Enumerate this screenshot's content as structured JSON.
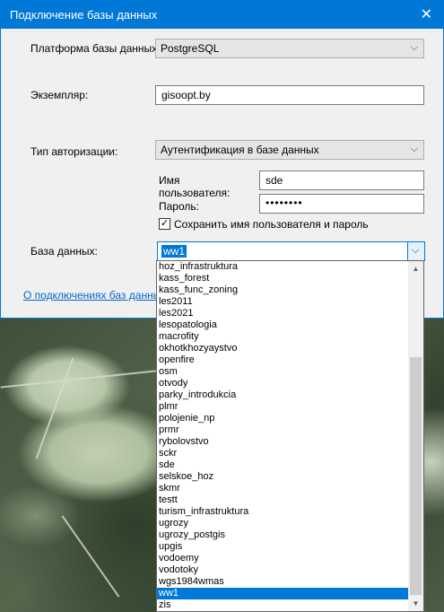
{
  "window": {
    "title": "Подключение базы данных",
    "close_glyph": "✕"
  },
  "form": {
    "platform_label": "Платформа базы данных:",
    "platform_value": "PostgreSQL",
    "instance_label": "Экземпляр:",
    "instance_value": "gisoopt.by",
    "auth_label": "Тип авторизации:",
    "auth_value": "Аутентификация в базе данных",
    "username_label_line1": "Имя",
    "username_label_line2": "пользователя:",
    "username_value": "sde",
    "password_label": "Пароль:",
    "password_value": "••••••••",
    "save_checked": true,
    "save_label": "Сохранить имя пользователя и пароль",
    "database_label": "База данных:",
    "database_value": "ww1",
    "about_link": "О подключениях баз данных"
  },
  "dropdown": {
    "items": [
      "hoz_infrastruktura",
      "kass_forest",
      "kass_func_zoning",
      "les2011",
      "les2021",
      "lesopatologia",
      "macrofity",
      "okhotkhozyaystvo",
      "openfire",
      "osm",
      "otvody",
      "parky_introdukcia",
      "plmr",
      "polojenie_np",
      "prmr",
      "rybolovstvo",
      "sckr",
      "sde",
      "selskoe_hoz",
      "skmr",
      "testt",
      "turism_infrastruktura",
      "ugrozy",
      "ugrozy_postgis",
      "upgis",
      "vodoemy",
      "vodotoky",
      "wgs1984wmas",
      "ww1",
      "zis"
    ],
    "selected": "ww1"
  },
  "icons": {
    "chevron": "chevron-down-icon",
    "close": "close-icon",
    "check": "checkmark-icon"
  },
  "colors": {
    "accent": "#0078d7",
    "link": "#0066cc"
  }
}
